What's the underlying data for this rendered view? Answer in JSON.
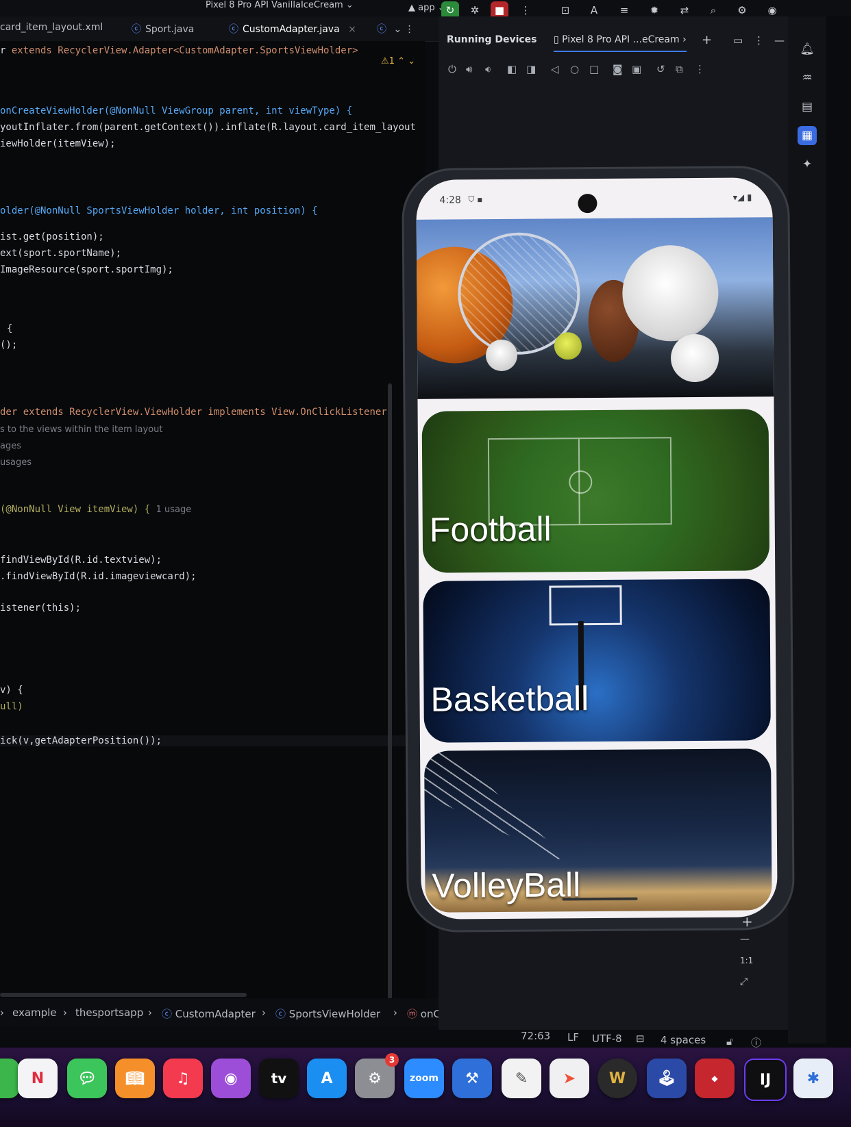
{
  "topbar": {
    "device_title": "Pixel 8 Pro API VanillaIceCream",
    "app_selector": "app"
  },
  "editor": {
    "tabs": [
      {
        "label": "card_item_layout.xml",
        "active": false
      },
      {
        "label": "Sport.java",
        "active": false
      },
      {
        "label": "CustomAdapter.java",
        "active": true
      }
    ],
    "warnings": "1",
    "code": {
      "l1": "extends RecyclerView.Adapter<CustomAdapter.SportsViewHolder>",
      "l2": "onCreateViewHolder(@NonNull ViewGroup parent, int viewType) {",
      "l3": "youtInflater.from(parent.getContext()).inflate(R.layout.card_item_layout",
      "l4": "iewHolder(itemView);",
      "l5": "older(@NonNull SportsViewHolder holder, int position) {",
      "l6": "ist.get(position);",
      "l7": "ext(sport.sportName);",
      "l8": "ImageResource(sport.sportImg);",
      "l9": "{",
      "l10": "();",
      "l11": "der extends RecyclerView.ViewHolder implements View.OnClickListener{",
      "l12": "s to the views within the item layout",
      "l13": "ages",
      "l14": "usages",
      "l15": "(@NonNull View itemView) {",
      "l15_hint": "1 usage",
      "l16": "findViewById(R.id.textview);",
      "l17": ".findViewById(R.id.imageviewcard);",
      "l18": "istener(this);",
      "l19": "v) {",
      "l20": "ull)",
      "l21": "ick(v,getAdapterPosition());"
    }
  },
  "breadcrumb": [
    "example",
    "thesportsapp",
    "CustomAdapter",
    "SportsViewHolder",
    "onClick"
  ],
  "running_devices": {
    "title": "Running Devices",
    "device_tab": "Pixel 8 Pro API ...eCream"
  },
  "phone": {
    "time": "4:28",
    "cards": [
      {
        "label": "Football"
      },
      {
        "label": "Basketball"
      },
      {
        "label": "VolleyBall"
      }
    ]
  },
  "zoom": {
    "plus": "+",
    "minus": "—",
    "ratio": "1:1"
  },
  "status": {
    "position": "72:63",
    "line_ending": "LF",
    "encoding": "UTF-8",
    "indent": "4 spaces"
  },
  "dock": {
    "zoom_label": "zoom",
    "tv_label": "tv",
    "ij_label": "IJ",
    "settings_badge": "3"
  },
  "colors": {
    "accent": "#3f7cff",
    "run": "#2c8a3b",
    "stop": "#b3262a"
  }
}
